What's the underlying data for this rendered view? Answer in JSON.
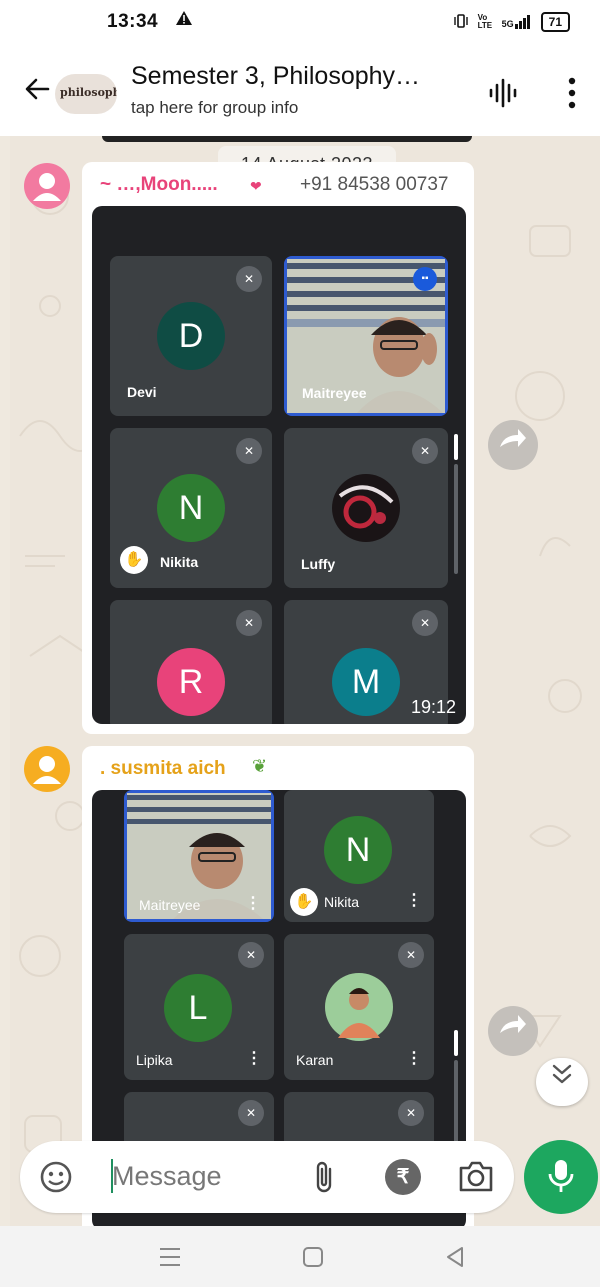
{
  "status_bar": {
    "time": "13:34",
    "signal": "5G",
    "volte": "Vo LTE",
    "battery": "71"
  },
  "header": {
    "title": "Semester 3, Philosophy…",
    "subtitle": "tap here for group info",
    "avatar_text": "philosophy"
  },
  "date_divider": "14 August 2023",
  "messages": [
    {
      "sender_name": "~ …,Moon.....",
      "sender_phone": "+91 84538 00737",
      "time": "19:12",
      "participants": [
        {
          "initial": "D",
          "name": "Devi",
          "color": "#0f4c44"
        },
        {
          "initial": "",
          "name": "Maitreyee",
          "color": ""
        },
        {
          "initial": "N",
          "name": "Nikita",
          "color": "#2e7d32"
        },
        {
          "initial": "",
          "name": "Luffy",
          "color": ""
        },
        {
          "initial": "R",
          "name": "",
          "color": "#e8437a"
        },
        {
          "initial": "M",
          "name": "",
          "color": "#0b7e8c"
        }
      ]
    },
    {
      "sender_name": ". susmita aich",
      "participants": [
        {
          "initial": "",
          "name": "Maitreyee",
          "color": ""
        },
        {
          "initial": "N",
          "name": "Nikita",
          "color": "#2e7d32"
        },
        {
          "initial": "L",
          "name": "Lipika",
          "color": "#2e7d32"
        },
        {
          "initial": "",
          "name": "Karan",
          "color": ""
        }
      ]
    }
  ],
  "composer": {
    "placeholder": "Message"
  },
  "colors": {
    "accent_green": "#1da75f",
    "sender1": "#e8437a",
    "sender2": "#e5a21a"
  },
  "icons": [
    "back-arrow-icon",
    "voice-chat-icon",
    "more-vert-icon",
    "forward-icon",
    "chevron-down-icon",
    "sticker-icon",
    "attach-icon",
    "rupee-icon",
    "camera-icon",
    "mic-icon",
    "nav-menu-icon",
    "nav-home-icon",
    "nav-back-icon"
  ]
}
